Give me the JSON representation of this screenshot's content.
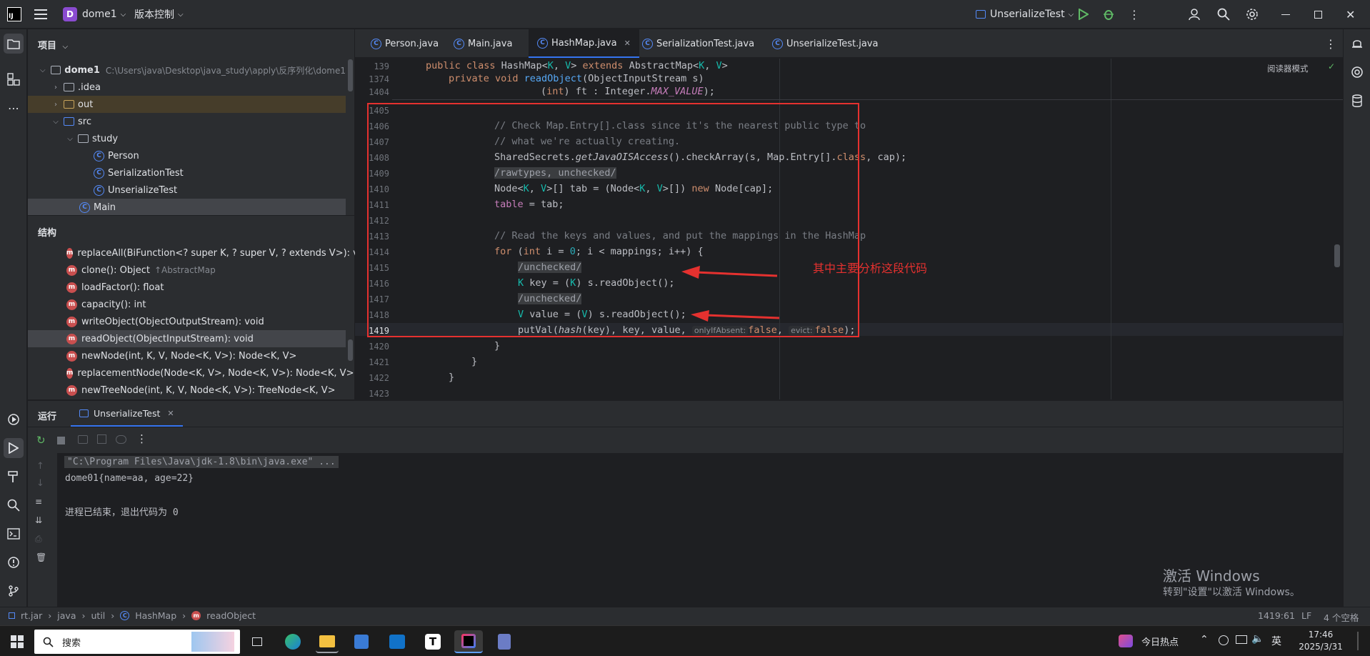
{
  "titlebar": {
    "project_initial": "D",
    "project_name": "dome1",
    "vcs": "版本控制",
    "run_config": "UnserializeTest"
  },
  "project_panel": {
    "title": "项目",
    "tree": [
      {
        "label": "dome1",
        "path": "C:\\Users\\java\\Desktop\\java_study\\apply\\反序列化\\dome1"
      },
      {
        "label": ".idea"
      },
      {
        "label": "out"
      },
      {
        "label": "src"
      },
      {
        "label": "study"
      },
      {
        "label": "Person"
      },
      {
        "label": "SerializationTest"
      },
      {
        "label": "UnserializeTest"
      },
      {
        "label": "Main"
      }
    ]
  },
  "structure_panel": {
    "title": "结构",
    "items": [
      {
        "label": "replaceAll(BiFunction<? super K, ? super V, ? extends V>): void",
        "extra": ""
      },
      {
        "label": "clone(): Object",
        "extra": "↑AbstractMap"
      },
      {
        "label": "loadFactor(): float",
        "extra": ""
      },
      {
        "label": "capacity(): int",
        "extra": ""
      },
      {
        "label": "writeObject(ObjectOutputStream): void",
        "extra": ""
      },
      {
        "label": "readObject(ObjectInputStream): void",
        "extra": ""
      },
      {
        "label": "newNode(int, K, V, Node<K, V>): Node<K, V>",
        "extra": ""
      },
      {
        "label": "replacementNode(Node<K, V>, Node<K, V>): Node<K, V>",
        "extra": ""
      },
      {
        "label": "newTreeNode(int, K, V, Node<K, V>): TreeNode<K, V>",
        "extra": ""
      }
    ]
  },
  "editor": {
    "tabs": [
      "Person.java",
      "Main.java",
      "HashMap.java",
      "SerializationTest.java",
      "UnserializeTest.java"
    ],
    "active_tab": "HashMap.java",
    "reader_mode": "阅读器模式",
    "line_numbers": [
      "139",
      "1374",
      "1404",
      "1405",
      "1406",
      "1407",
      "1408",
      "1409",
      "1410",
      "1411",
      "1412",
      "1413",
      "1414",
      "1415",
      "1416",
      "1417",
      "1418",
      "1419",
      "1420",
      "1421",
      "1422",
      "1423"
    ],
    "annotation": "其中主要分析这段代码",
    "hints": {
      "only_if_absent": "onlyIfAbsent:",
      "evict": "evict:"
    },
    "code": {
      "l139_a": "public class ",
      "l139_b": "HashMap",
      "l139_c": "<",
      "l139_d": "K",
      "l139_e": ", ",
      "l139_f": "V",
      "l139_g": "> ",
      "l139_h": "extends ",
      "l139_i": "AbstractMap<",
      "l139_j": "K",
      "l139_k": ", ",
      "l139_l": "V",
      "l139_m": ">",
      "l1374_a": "private void ",
      "l1374_b": "readObject",
      "l1374_c": "(ObjectInputStream s)",
      "l1404_a": "(",
      "l1404_b": "int",
      "l1404_c": ") ft : Integer.",
      "l1404_d": "MAX_VALUE",
      "l1404_e": ");",
      "l1406": "// Check Map.Entry[].class since it's the nearest public type to",
      "l1407": "// what we're actually creating.",
      "l1408_a": "SharedSecrets.",
      "l1408_b": "getJavaOISAccess",
      "l1408_c": "().checkArray(s, Map.Entry[].",
      "l1408_d": "class",
      "l1408_e": ", cap);",
      "l1409": "/rawtypes, unchecked/",
      "l1410_a": "Node<",
      "l1410_b": "K",
      "l1410_c": ", ",
      "l1410_d": "V",
      "l1410_e": ">[] tab = (Node<",
      "l1410_f": "K",
      "l1410_g": ", ",
      "l1410_h": "V",
      "l1410_i": ">[]) ",
      "l1410_j": "new ",
      "l1410_k": "Node[cap];",
      "l1411_a": "table",
      "l1411_b": " = tab;",
      "l1413": "// Read the keys and values, and put the mappings in the HashMap",
      "l1414_a": "for ",
      "l1414_b": "(",
      "l1414_c": "int ",
      "l1414_d": "i = ",
      "l1414_e": "0",
      "l1414_f": "; i < mappings; i++) {",
      "l1415": "/unchecked/",
      "l1416_a": "K",
      "l1416_b": " key = (",
      "l1416_c": "K",
      "l1416_d": ") s.readObject();",
      "l1417": "/unchecked/",
      "l1418_a": "V",
      "l1418_b": " value = (",
      "l1418_c": "V",
      "l1418_d": ") s.readObject();",
      "l1419_a": "putVal(",
      "l1419_b": "hash",
      "l1419_c": "(key), key, value, ",
      "l1419_d": "false",
      "l1419_e": ", ",
      "l1419_f": "false",
      "l1419_g": ");",
      "l1420": "}",
      "l1421": "}",
      "l1422": "}"
    }
  },
  "run_panel": {
    "title": "运行",
    "tab": "UnserializeTest",
    "console": [
      "\"C:\\Program Files\\Java\\jdk-1.8\\bin\\java.exe\" ...",
      "dome01{name=aa, age=22}",
      "",
      "进程已结束，退出代码为 0"
    ],
    "watermark_title": "激活 Windows",
    "watermark_sub": "转到\"设置\"以激活 Windows。"
  },
  "statusbar": {
    "breadcrumb": [
      "rt.jar",
      "java",
      "util",
      "HashMap",
      "readObject"
    ],
    "position": "1419:61",
    "line_sep": "LF",
    "indent": "4 个空格"
  },
  "taskbar": {
    "search": "搜索",
    "news": "今日热点",
    "ime": "英",
    "time": "17:46",
    "date": "2025/3/31"
  },
  "colors": {
    "accent": "#3574f0",
    "annotation_red": "#e5312f",
    "keyword": "#cf8e6d",
    "function": "#56a8f5",
    "comment": "#7a7e85",
    "type_param": "#16baac"
  }
}
